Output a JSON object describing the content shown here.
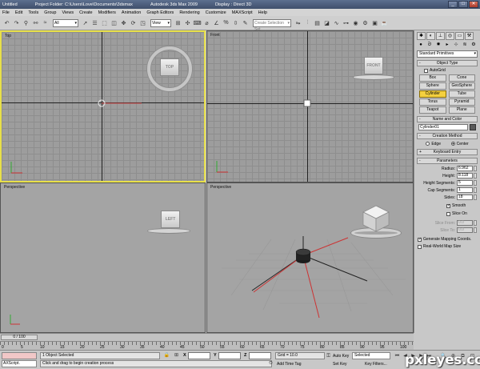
{
  "titlebar": {
    "doc": "Untitled",
    "folder": "Project Folder: C:\\Users\\Love\\Documents\\3dsmax",
    "app": "Autodesk 3ds Max 2009",
    "display": "Display : Direct 3D",
    "buttons": [
      "_",
      "□",
      "✕"
    ]
  },
  "menu": [
    "File",
    "Edit",
    "Tools",
    "Group",
    "Views",
    "Create",
    "Modifiers",
    "Animation",
    "Graph Editors",
    "Rendering",
    "Customize",
    "MAXScript",
    "Help"
  ],
  "toolbar": {
    "filter_value": "All",
    "view_value": "View",
    "selection_set_placeholder": "Create Selection Set"
  },
  "viewports": {
    "top": {
      "label": "Top",
      "cube": "TOP"
    },
    "front": {
      "label": "Front",
      "cube": "FRONT"
    },
    "left": {
      "label": "Perspective",
      "cube": "LEFT"
    },
    "perspective": {
      "label": "Perspective"
    }
  },
  "command_panel": {
    "category": "Standard Primitives",
    "object_type": {
      "title": "Object Type",
      "autogrid": "AutoGrid",
      "buttons": [
        "Box",
        "Cone",
        "Sphere",
        "GeoSphere",
        "Cylinder",
        "Tube",
        "Torus",
        "Pyramid",
        "Teapot",
        "Plane"
      ],
      "active": "Cylinder"
    },
    "name_color": {
      "title": "Name and Color",
      "name": "Cylinder01",
      "color": "#5a5a5a"
    },
    "creation_method": {
      "title": "Creation Method",
      "options": [
        "Edge",
        "Center"
      ],
      "selected": "Center"
    },
    "keyboard_entry": {
      "title": "Keyboard Entry"
    },
    "parameters": {
      "title": "Parameters",
      "radius_label": "Radius:",
      "radius": "6.962",
      "height_label": "Height:",
      "height": "8.118",
      "height_segments_label": "Height Segments:",
      "height_segments": "5",
      "cap_segments_label": "Cap Segments:",
      "cap_segments": "1",
      "sides_label": "Sides:",
      "sides": "18",
      "smooth": "Smooth",
      "slice_on": "Slice On",
      "slice_from_label": "Slice From:",
      "slice_from": "0.0",
      "slice_to_label": "Slice To:",
      "slice_to": "0.0",
      "gen_mapping": "Generate Mapping Coords.",
      "real_world": "Real-World Map Size"
    }
  },
  "timeline": {
    "slider": "0 / 100",
    "ticks": [
      "0",
      "5",
      "10",
      "15",
      "20",
      "25",
      "30",
      "35",
      "40",
      "45",
      "50",
      "55",
      "60",
      "65",
      "70",
      "75",
      "80",
      "85",
      "90",
      "95",
      "100"
    ]
  },
  "status": {
    "maxscript": "AXScript.",
    "selected": "1 Object Selected",
    "prompt": "Click and drag to begin creation process",
    "x_label": "X",
    "y_label": "Y",
    "z_label": "Z",
    "grid": "Grid = 10.0",
    "add_time_tag": "Add Time Tag",
    "auto_key": "Auto Key",
    "selected_dropdown": "Selected",
    "set_key": "Set Key",
    "key_filters": "Key Filters..."
  },
  "watermark": "pxleyes.com"
}
